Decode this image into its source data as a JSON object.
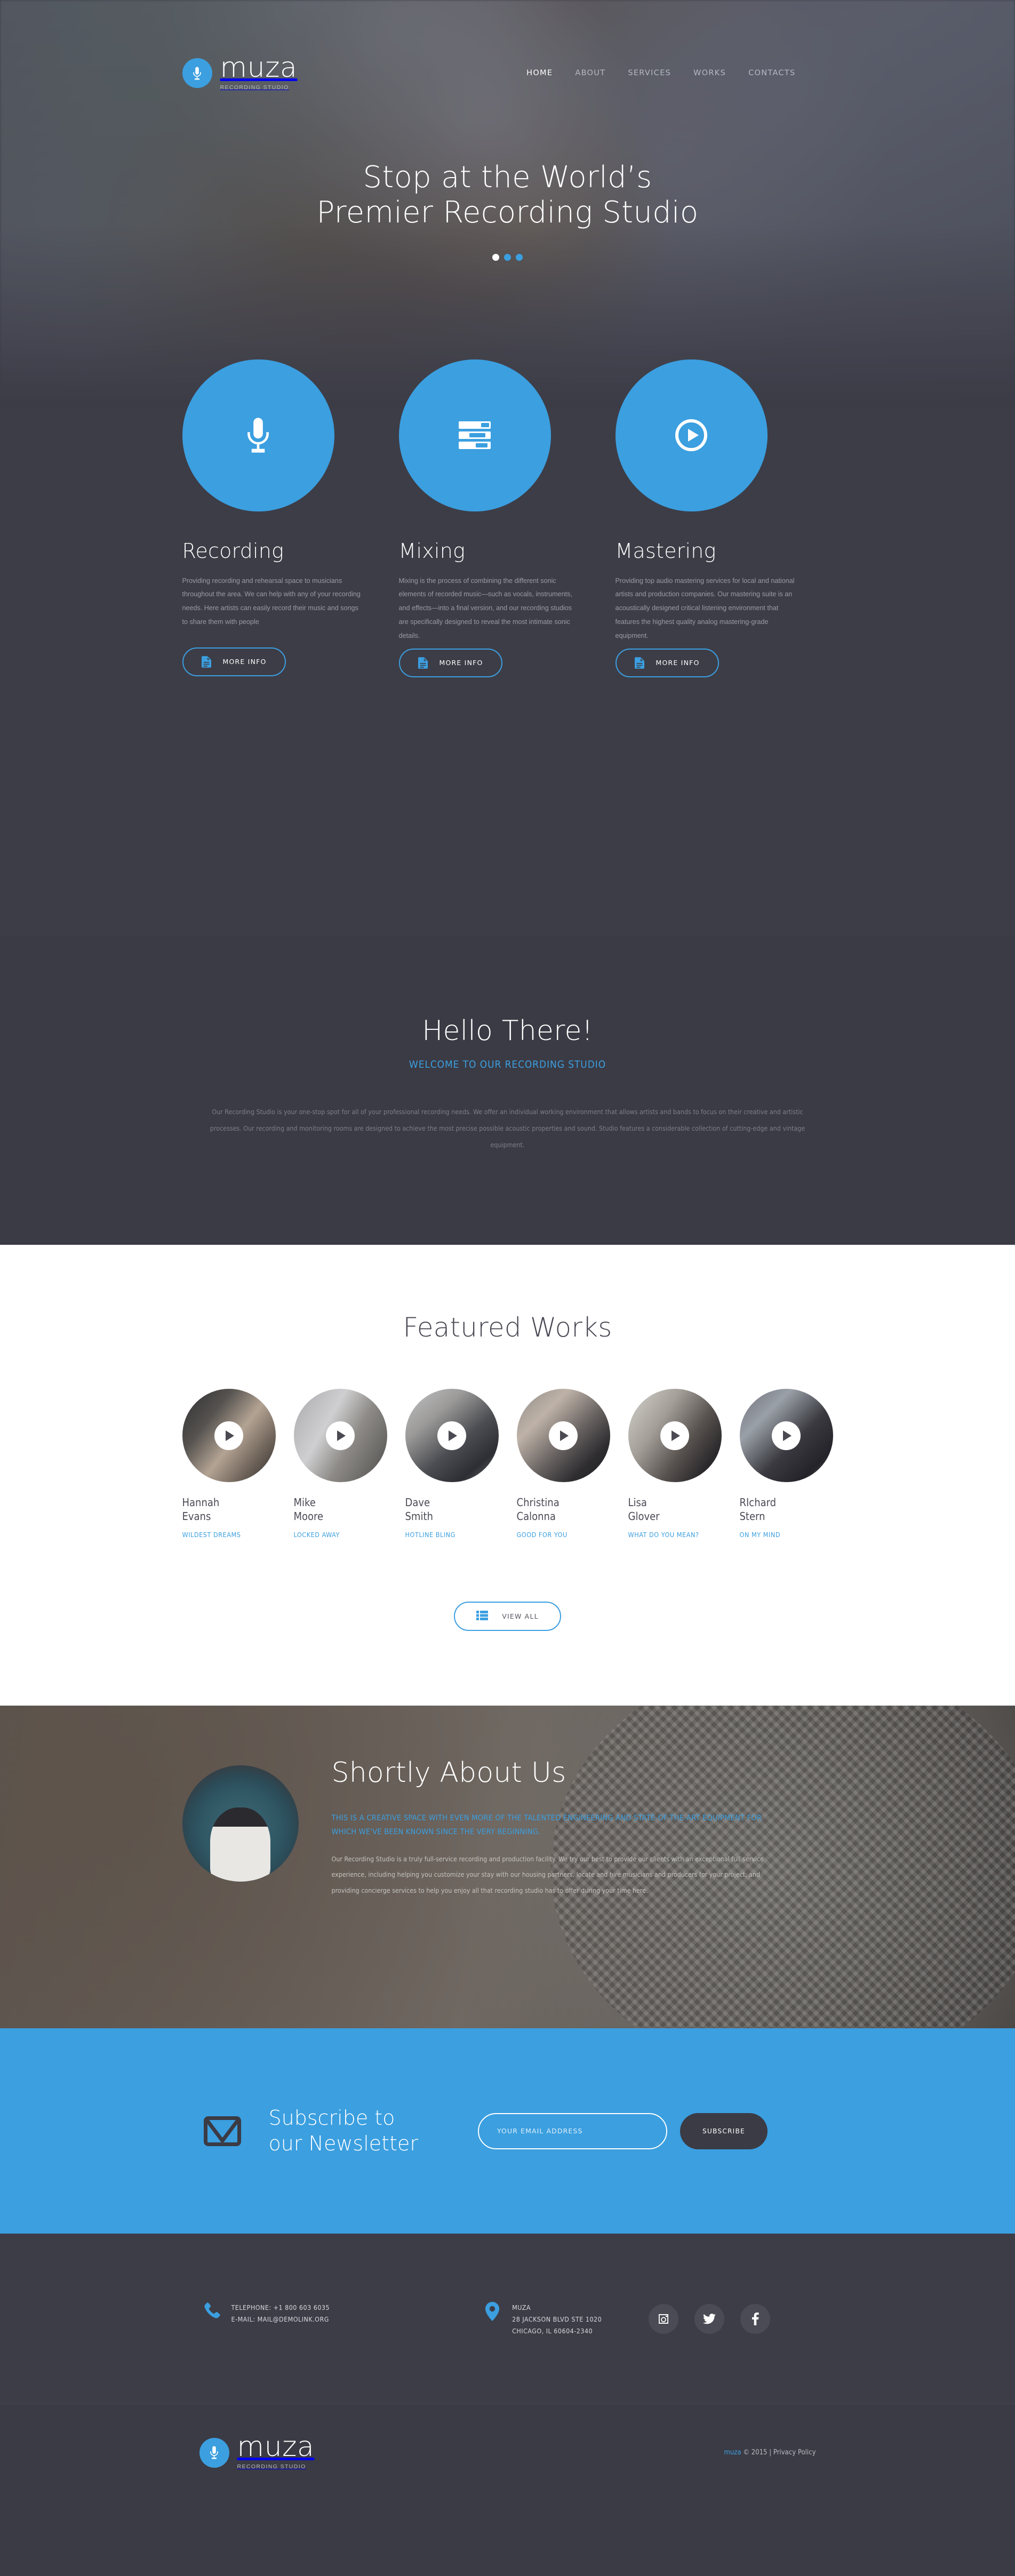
{
  "brand": {
    "name": "muza",
    "tagline": "RECORDING STUDIO",
    "mic_icon": "microphone-icon",
    "accent_color": "#3b9fe0",
    "dark_color": "#3b3b45"
  },
  "nav": {
    "items": [
      {
        "label": "HOME",
        "active": true
      },
      {
        "label": "ABOUT",
        "active": false
      },
      {
        "label": "SERVICES",
        "active": false
      },
      {
        "label": "WORKS",
        "active": false
      },
      {
        "label": "CONTACTS",
        "active": false
      }
    ]
  },
  "hero": {
    "title_line1": "Stop at the World’s",
    "title_line2": "Premier Recording Studio",
    "slider_dots": 3,
    "active_dot": 1
  },
  "services": {
    "items": [
      {
        "icon": "microphone-icon",
        "title": "Recording",
        "text": "Providing recording and rehearsal space to musicians throughout the area. We can help with any of your recording needs. Here artists can easily record their music and songs to share them with people",
        "button": "MORE INFO",
        "button_icon": "document-icon"
      },
      {
        "icon": "mixer-faders-icon",
        "title": "Mixing",
        "text": "Mixing is the process of combining the different sonic elements of recorded music—such as vocals, instruments, and effects—into a final version, and our recording studios are specifically designed to reveal the most intimate sonic details.",
        "button": "MORE INFO",
        "button_icon": "document-icon"
      },
      {
        "icon": "play-circle-icon",
        "title": "Mastering",
        "text": "Providing top audio mastering services for local and national artists and production companies. Our mastering suite is an acoustically designed critical listening environment that features the highest quality analog mastering-grade equipment.",
        "button": "MORE INFO",
        "button_icon": "document-icon"
      }
    ]
  },
  "hello": {
    "title": "Hello There!",
    "subtitle": "WELCOME TO OUR RECORDING STUDIO",
    "body": "Our Recording Studio is your one-stop spot for all of your professional recording needs. We offer an individual working environment that allows artists and bands to focus on their creative and artistic processes. Our recording and monitoring rooms are designed to achieve the most precise possible acoustic properties and sound. Studio features a considerable collection of cutting-edge and vintage equipment."
  },
  "works": {
    "title": "Featured Works",
    "play_icon": "play-icon",
    "items": [
      {
        "name_line1": "Hannah",
        "name_line2": "Evans",
        "track": "WILDEST DREAMS"
      },
      {
        "name_line1": "Mike",
        "name_line2": "Moore",
        "track": "LOCKED AWAY"
      },
      {
        "name_line1": "Dave",
        "name_line2": "Smith",
        "track": "HOTLINE BLING"
      },
      {
        "name_line1": "Christina",
        "name_line2": "Calonna",
        "track": "GOOD FOR YOU"
      },
      {
        "name_line1": "Lisa",
        "name_line2": "Glover",
        "track": "WHAT DO YOU MEAN?"
      },
      {
        "name_line1": "RIchard",
        "name_line2": "Stern",
        "track": "ON MY MIND"
      }
    ],
    "view_all": "VIEW ALL",
    "view_all_icon": "list-icon"
  },
  "about": {
    "title": "Shortly About Us",
    "lead": "THIS IS A CREATIVE SPACE WITH EVEN MORE OF THE TALENTED ENGINEERING AND STATE-OF-THE-ART EQUIPMENT FOR WHICH WE'VE BEEN KNOWN SINCE THE VERY BEGINNING.",
    "body": "Our Recording Studio is a truly full-service recording and production facility. We try our best to provide our clients with an exceptional full service experience, including helping you customize your stay with our housing partners, locate and hire musicians and producers for your project, and providing concierge services to help you enjoy all that recording studio has to offer during your time here.",
    "avatar": "person-with-headphones-photo"
  },
  "subscribe": {
    "icon": "envelope-icon",
    "title_line1": "Subscribe to",
    "title_line2": "our Newsletter",
    "input_value": "",
    "input_placeholder": "YOUR EMAIL ADDRESS",
    "button": "SUBSCRIBE"
  },
  "footer": {
    "phone_icon": "phone-icon",
    "telephone": "TELEPHONE: +1 800 603 6035",
    "email": "E-MAIL: MAIL@DEMOLINK.ORG",
    "map_icon": "map-pin-icon",
    "address_line1": "MUZA",
    "address_line2": "28 JACKSON BLVD STE 1020",
    "address_line3": "CHICAGO, IL 60604-2340",
    "socials": [
      {
        "name": "instagram-icon"
      },
      {
        "name": "twitter-icon"
      },
      {
        "name": "facebook-icon"
      }
    ],
    "copyright_brand": "muza",
    "copyright_text": "© 2015 |",
    "privacy": "Privacy Policy"
  }
}
